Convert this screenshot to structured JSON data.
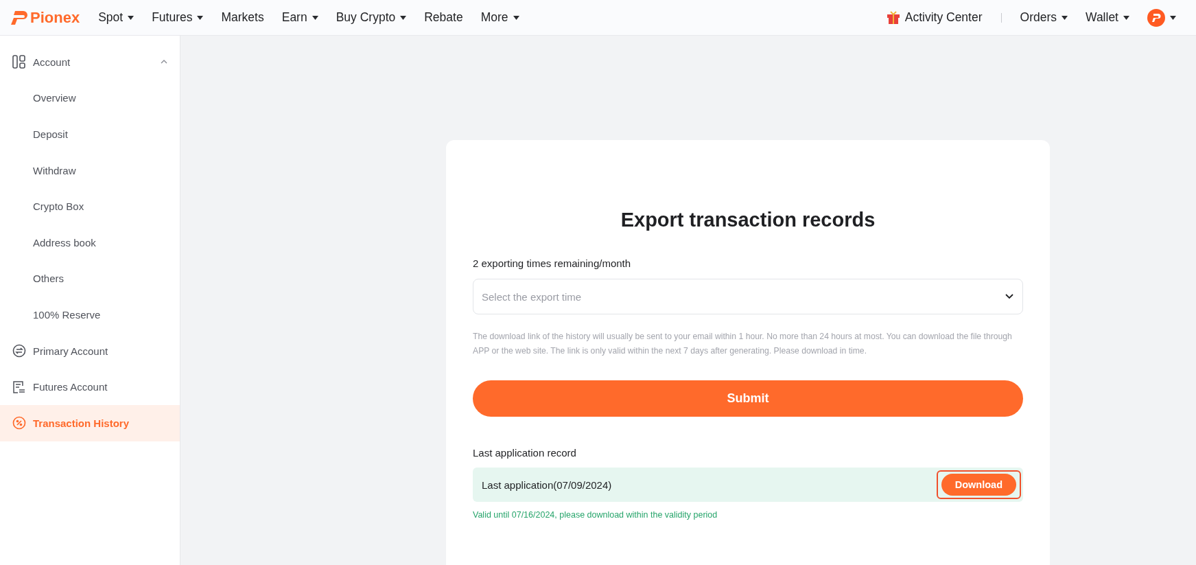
{
  "header": {
    "logo": "Pionex",
    "nav": [
      {
        "label": "Spot",
        "caret": true
      },
      {
        "label": "Futures",
        "caret": true
      },
      {
        "label": "Markets",
        "caret": false
      },
      {
        "label": "Earn",
        "caret": true
      },
      {
        "label": "Buy Crypto",
        "caret": true
      },
      {
        "label": "Rebate",
        "caret": false
      },
      {
        "label": "More",
        "caret": true
      }
    ],
    "activity": "Activity Center",
    "right_nav": [
      {
        "label": "Orders",
        "caret": true
      },
      {
        "label": "Wallet",
        "caret": true
      }
    ]
  },
  "sidebar": {
    "items": [
      {
        "label": "Account",
        "kind": "grid",
        "selected": false,
        "expanded": true,
        "children": [
          {
            "label": "Overview",
            "selected": false
          },
          {
            "label": "Deposit",
            "selected": false
          },
          {
            "label": "Withdraw",
            "selected": false
          },
          {
            "label": "Crypto Box",
            "selected": false
          },
          {
            "label": "Address book",
            "selected": false
          },
          {
            "label": "Others",
            "selected": false
          },
          {
            "label": "100% Reserve",
            "selected": false
          }
        ]
      },
      {
        "label": "Primary Account",
        "kind": "swap",
        "selected": false
      },
      {
        "label": "Futures Account",
        "kind": "futures",
        "selected": false
      },
      {
        "label": "Transaction History",
        "kind": "percent",
        "selected": true
      }
    ]
  },
  "card": {
    "title": "Export transaction records",
    "remaining": "2 exporting times remaining/month",
    "select": {
      "placeholder": "Select the export time"
    },
    "note": "The download link of the history will usually be sent to your email within 1 hour. No more than 24 hours at most. You can download the file through APP or the web site. The link is only valid within the next 7 days after generating. Please download in time.",
    "submit": "Submit",
    "record_heading": "Last application record",
    "record": {
      "label": "Last application(07/09/2024)",
      "button": "Download",
      "highlighted": true
    },
    "validity": "Valid until 07/16/2024, please download within the validity period"
  }
}
